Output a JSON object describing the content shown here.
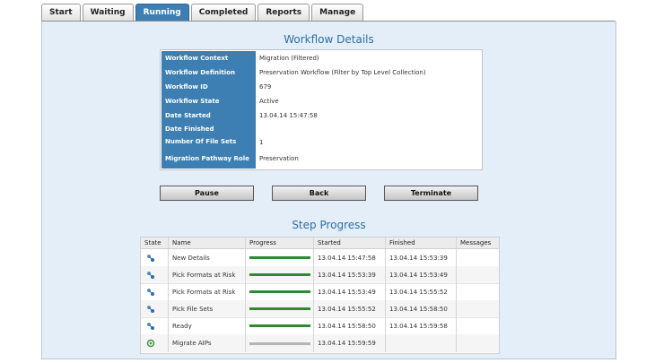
{
  "tabs": [
    {
      "label": "Start",
      "active": false
    },
    {
      "label": "Waiting",
      "active": false
    },
    {
      "label": "Running",
      "active": true
    },
    {
      "label": "Completed",
      "active": false
    },
    {
      "label": "Reports",
      "active": false
    },
    {
      "label": "Manage",
      "active": false
    }
  ],
  "details": {
    "title": "Workflow Details",
    "rows": [
      {
        "label": "Workflow Context",
        "value": "Migration (Filtered)"
      },
      {
        "label": "Workflow Definition",
        "value": "Preservation Workflow (Filter by Top Level Collection)"
      },
      {
        "label": "Workflow ID",
        "value": "679"
      },
      {
        "label": "Workflow State",
        "value": "Active"
      },
      {
        "label": "Date Started",
        "value": "13.04.14 15:47:58"
      },
      {
        "label": "Date Finished",
        "value": ""
      },
      {
        "label": "Number Of File Sets",
        "value": "1"
      },
      {
        "label": "Migration Pathway Role",
        "value": "Preservation"
      }
    ]
  },
  "buttons": {
    "pause": "Pause",
    "back": "Back",
    "terminate": "Terminate"
  },
  "steps": {
    "title": "Step Progress",
    "columns": [
      "State",
      "Name",
      "Progress",
      "Started",
      "Finished",
      "Messages"
    ],
    "rows": [
      {
        "state_icon": "workflow-done-icon",
        "name": "New Details",
        "progress": 1.0,
        "started": "13.04.14 15:47:58",
        "finished": "13.04.14 15:53:39",
        "messages": ""
      },
      {
        "state_icon": "workflow-done-icon",
        "name": "Pick Formats at Risk",
        "progress": 1.0,
        "started": "13.04.14 15:53:39",
        "finished": "13.04.14 15:53:49",
        "messages": ""
      },
      {
        "state_icon": "workflow-done-icon",
        "name": "Pick Formats at Risk",
        "progress": 1.0,
        "started": "13.04.14 15:53:49",
        "finished": "13.04.14 15:55:52",
        "messages": ""
      },
      {
        "state_icon": "workflow-done-icon",
        "name": "Pick File Sets",
        "progress": 1.0,
        "started": "13.04.14 15:55:52",
        "finished": "13.04.14 15:58:50",
        "messages": ""
      },
      {
        "state_icon": "workflow-done-icon",
        "name": "Ready",
        "progress": 1.0,
        "started": "13.04.14 15:58:50",
        "finished": "13.04.14 15:59:58",
        "messages": ""
      },
      {
        "state_icon": "running-state-icon",
        "name": "Migrate AIPs",
        "progress": 0.0,
        "started": "13.04.14 15:59:59",
        "finished": "",
        "messages": ""
      }
    ]
  },
  "colors": {
    "accent": "#3d7fb2",
    "heading": "#2e6fa6",
    "panel_bg": "#e3eef8",
    "progress_done": "#2d8a32",
    "progress_pending": "#b4b4b4"
  }
}
